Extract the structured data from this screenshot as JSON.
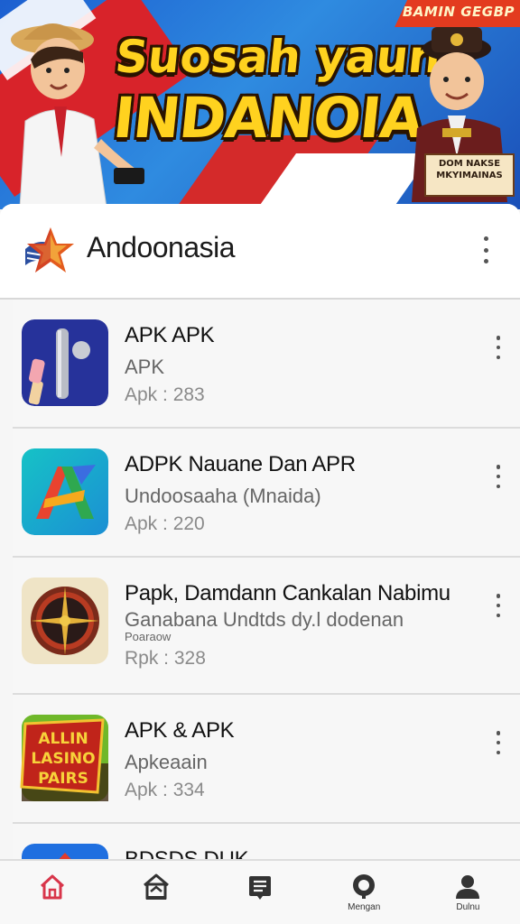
{
  "banner": {
    "corner_text": "BAMIN GEGBP",
    "title_line1": "Suosah yaun",
    "title_line2": "INDANOIA",
    "badge_line1": "DOM NAKSE",
    "badge_line2": "MKYIMAINAS"
  },
  "header": {
    "title": "Andoonasia",
    "logo": "star-flag-logo"
  },
  "apps": [
    {
      "name": "APK APK",
      "subtitle": "APK",
      "subtitle2": "",
      "meta": "Apk : 283",
      "icon": "microphone-brush-icon"
    },
    {
      "name": "ADPK Nauane Dan APR",
      "subtitle": "Undoosaaha (Mnaida)",
      "subtitle2": "",
      "meta": "Apk : 220",
      "icon": "letter-a-icon"
    },
    {
      "name": "Papk, Damdann Cankalan Nabimu",
      "subtitle": "Ganabana Undtds dy.l dodenan",
      "subtitle2": "Poaraow",
      "meta": "Rpk : 328",
      "icon": "compass-emblem-icon"
    },
    {
      "name": "APK & APK",
      "subtitle": "Apkeaain",
      "subtitle2": "",
      "meta": "Apk : 334",
      "icon": "casino-badge-icon"
    },
    {
      "name": "BDSDS DUK",
      "subtitle": "",
      "subtitle2": "",
      "meta": "",
      "icon": "partial-app-icon"
    }
  ],
  "casino_badge": {
    "line1": "ALLIN",
    "line2": "LASINO",
    "line3": "PAIRS"
  },
  "nav": [
    {
      "label": "",
      "icon": "home-icon",
      "active": true
    },
    {
      "label": "",
      "icon": "store-icon",
      "active": false
    },
    {
      "label": "",
      "icon": "list-icon",
      "active": false
    },
    {
      "label": "Mengan",
      "icon": "support-icon",
      "active": false
    },
    {
      "label": "Dulnu",
      "icon": "profile-icon",
      "active": false
    }
  ],
  "colors": {
    "accent_active": "#d8354a",
    "banner_blue": "#1c5fd0",
    "banner_yellow": "#ffd21f",
    "flag_red": "#d8232a"
  }
}
